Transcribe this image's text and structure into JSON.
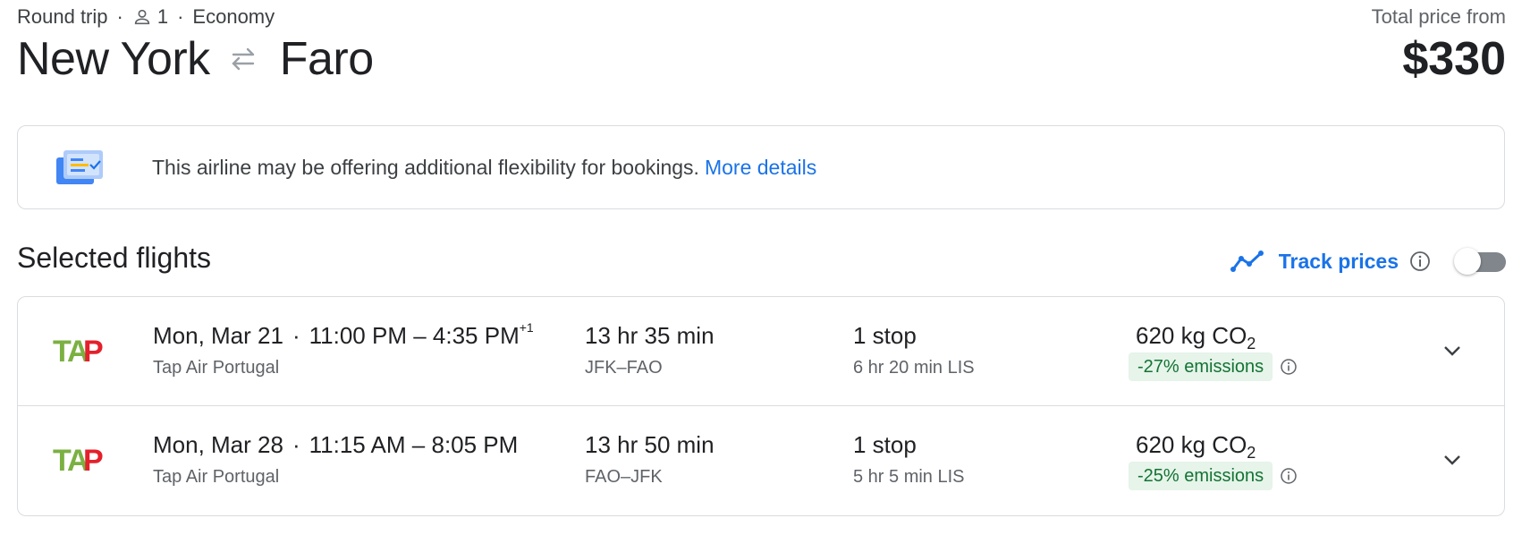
{
  "trip": {
    "type": "Round trip",
    "passengers": "1",
    "cabin": "Economy",
    "origin": "New York",
    "destination": "Faro"
  },
  "price": {
    "label": "Total price from",
    "value": "$330"
  },
  "banner": {
    "text": "This airline may be offering additional flexibility for bookings.",
    "link": "More details"
  },
  "section": {
    "title": "Selected flights",
    "track_label": "Track prices",
    "track_enabled": false
  },
  "colors": {
    "link": "#1a73e8",
    "emission_bg": "#e6f4ea",
    "emission_text": "#137333"
  },
  "flights": [
    {
      "date": "Mon, Mar 21",
      "depart": "11:00 PM",
      "arrive": "4:35 PM",
      "day_offset": "+1",
      "airline": "Tap Air Portugal",
      "duration": "13 hr 35 min",
      "route": "JFK–FAO",
      "stops": "1 stop",
      "layover": "6 hr 20 min LIS",
      "co2_value": "620 kg CO",
      "co2_sub": "2",
      "emissions": "-27% emissions"
    },
    {
      "date": "Mon, Mar 28",
      "depart": "11:15 AM",
      "arrive": "8:05 PM",
      "day_offset": "",
      "airline": "Tap Air Portugal",
      "duration": "13 hr 50 min",
      "route": "FAO–JFK",
      "stops": "1 stop",
      "layover": "5 hr 5 min LIS",
      "co2_value": "620 kg CO",
      "co2_sub": "2",
      "emissions": "-25% emissions"
    }
  ]
}
